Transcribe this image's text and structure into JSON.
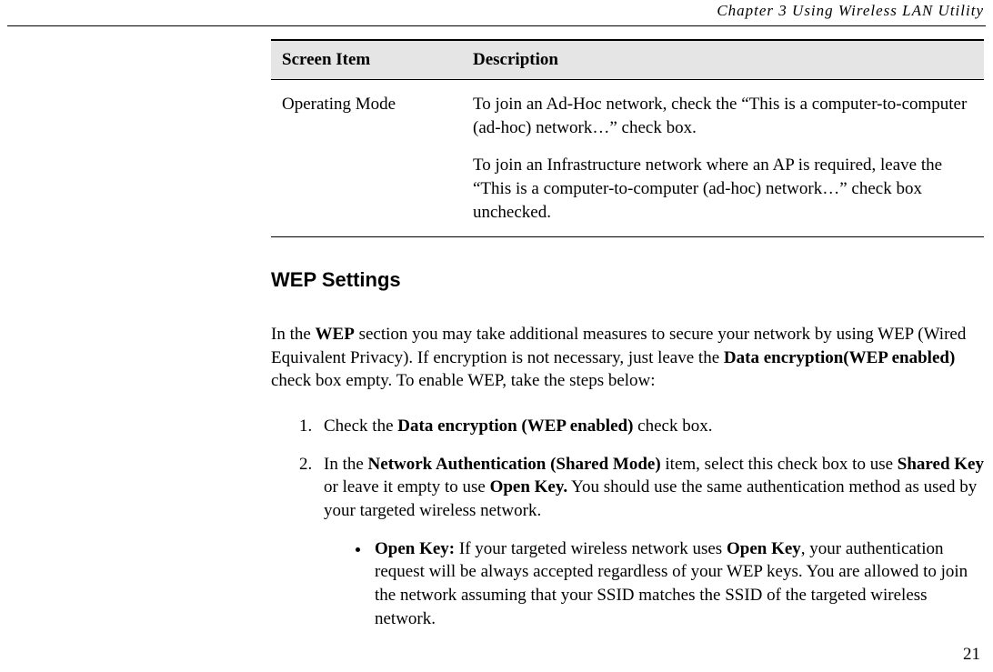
{
  "header": {
    "chapter": "Chapter  3    Using  Wireless  LAN  Utility"
  },
  "table": {
    "header_item": "Screen Item",
    "header_desc": "Description",
    "row1_item": "Operating Mode",
    "row1_desc_p1": "To join an Ad-Hoc network, check the “This is a computer-to-computer (ad-hoc) network…” check box.",
    "row1_desc_p2": "To join an Infrastructure network where an AP is required, leave the “This is a computer-to-computer (ad-hoc) network…” check box unchecked."
  },
  "section_heading": "WEP Settings",
  "intro": {
    "t1": "In the ",
    "b1": "WEP",
    "t2": " section you may take additional measures to secure your network by using WEP (Wired Equivalent Privacy). If encryption is not necessary, just leave the ",
    "b2": "Data encryption(WEP enabled)",
    "t3": " check box empty. To enable WEP, take the steps below:"
  },
  "steps": {
    "s1": {
      "t1": "Check the ",
      "b1": "Data encryption (WEP enabled)",
      "t2": " check box."
    },
    "s2": {
      "t1": "In the ",
      "b1": "Network Authentication (Shared Mode)",
      "t2": " item, select this check box to use ",
      "b2": "Shared Key",
      "t3": " or leave it empty to use ",
      "b3": "Open Key.",
      "t4": " You should use the same authentication method as used by your targeted wireless network."
    }
  },
  "bullets": {
    "openkey": {
      "b1": "Open Key:",
      "t1": " If your targeted wireless network uses ",
      "b2": "Open Key",
      "t2": ", your authentication request will be always accepted regardless of your WEP keys. You are allowed to join the network assuming that your SSID matches the SSID of the targeted wireless network."
    }
  },
  "page_number": "21"
}
